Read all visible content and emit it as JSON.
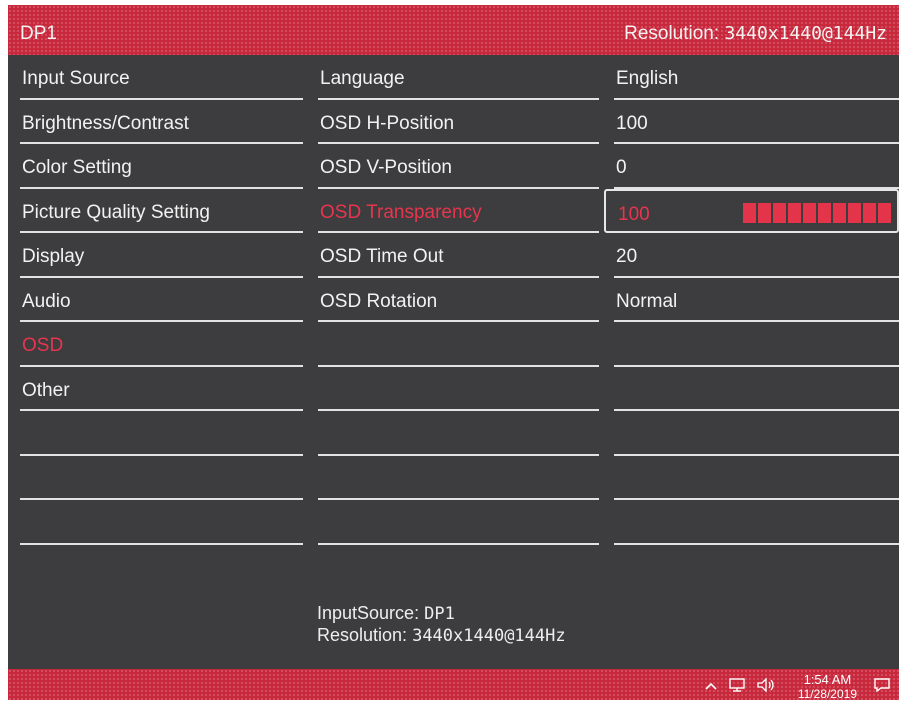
{
  "header": {
    "input": "DP1",
    "resolution_label": "Resolution:",
    "resolution_value": "3440x1440@144Hz"
  },
  "menu": {
    "items": [
      {
        "label": "Input Source"
      },
      {
        "label": "Brightness/Contrast"
      },
      {
        "label": "Color Setting"
      },
      {
        "label": "Picture Quality Setting"
      },
      {
        "label": "Display"
      },
      {
        "label": "Audio"
      },
      {
        "label": "OSD"
      },
      {
        "label": "Other"
      }
    ],
    "active_item": "OSD"
  },
  "submenu": {
    "items": [
      {
        "label": "Language",
        "value": "English"
      },
      {
        "label": "OSD H-Position",
        "value": "100"
      },
      {
        "label": "OSD V-Position",
        "value": "0"
      },
      {
        "label": "OSD Transparency",
        "value": "100"
      },
      {
        "label": "OSD Time Out",
        "value": "20"
      },
      {
        "label": "OSD Rotation",
        "value": "Normal"
      }
    ],
    "selected_item": "OSD Transparency",
    "selected_level_fraction": 1.0
  },
  "footer_info": {
    "input_label": "InputSource:",
    "input_value": "DP1",
    "resolution_label": "Resolution:",
    "resolution_value": "3440x1440@144Hz"
  },
  "taskbar": {
    "time": "1:54 AM",
    "date": "11/28/2019",
    "icons": [
      "chevron-up-icon",
      "network-icon",
      "speaker-icon",
      "notification-icon"
    ]
  },
  "colors": {
    "accent": "#c8283c",
    "highlight_text": "#e8344d",
    "panel_bg": "#3d3d3f"
  }
}
